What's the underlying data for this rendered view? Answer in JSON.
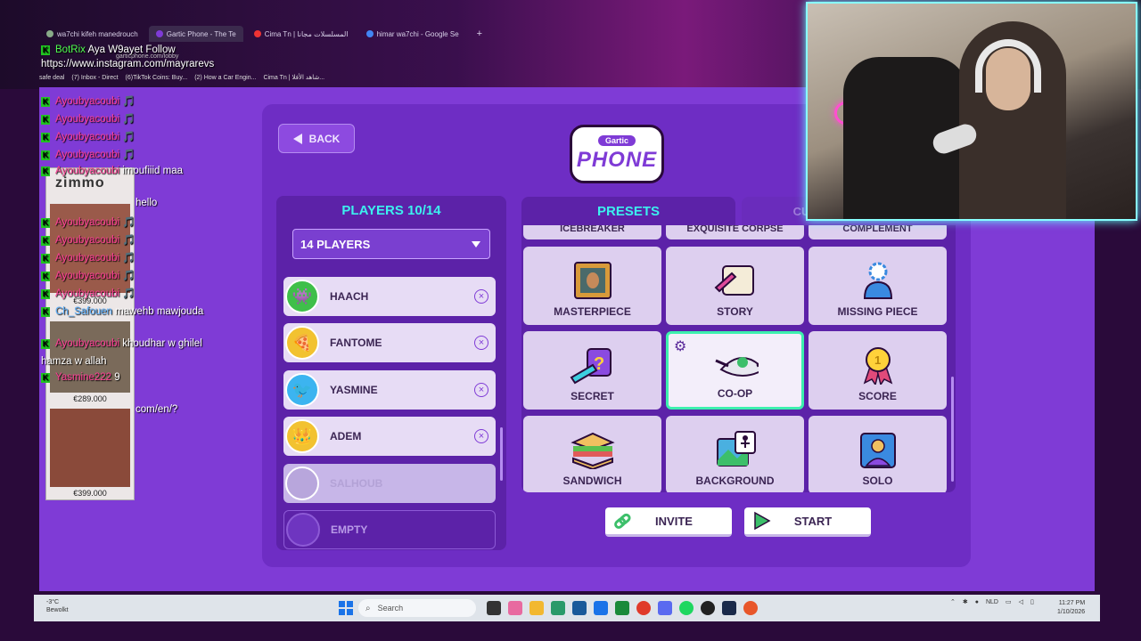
{
  "browser": {
    "tabs": [
      {
        "label": "wa7chi kifeh manedrouch",
        "active": false
      },
      {
        "label": "Gartic Phone - The Te",
        "active": true
      },
      {
        "label": "Cima Tn | المسلسلات مجانا",
        "active": false
      },
      {
        "label": "himar wa7chi - Google Se",
        "active": false
      }
    ],
    "new_tab": "+",
    "url": "garticphone.com/lobby",
    "bookmarks": [
      "safe deal",
      "(7) Inbox - Direct",
      "(6)TikTok Coins: Buy...",
      "(2) How a Car Engin...",
      "Cima Tn | شاهد الأفلا..."
    ]
  },
  "game": {
    "back_label": "BACK",
    "logo_top": "Gartic",
    "logo_main": "PHONE",
    "players_title": "PLAYERS 10/14",
    "players_select": "14 PLAYERS",
    "players": [
      {
        "name": "HAACH",
        "icon": "green-monster-avatar",
        "color": "#3fbf4a"
      },
      {
        "name": "FANTOME",
        "icon": "pizza-avatar",
        "color": "#f2c230"
      },
      {
        "name": "YASMINE",
        "icon": "blue-bird-avatar",
        "color": "#3cb4f0"
      },
      {
        "name": "ADEM",
        "icon": "crowned-king-avatar",
        "color": "#f2c230"
      },
      {
        "name": "SALHOUB",
        "icon": "faded-avatar",
        "color": "#b8a6dc"
      },
      {
        "name": "EMPTY",
        "icon": "empty-slot-avatar",
        "color": "#6e35c0"
      }
    ],
    "remove_symbol": "×",
    "presets_tab": "PRESETS",
    "custom_tab": "CUSTOM SETTINGS",
    "preset_top_row": [
      "ICEBREAKER",
      "EXQUISITE CORPSE",
      "COMPLEMENT"
    ],
    "presets": [
      {
        "label": "MASTERPIECE",
        "icon": "painting-icon"
      },
      {
        "label": "STORY",
        "icon": "scroll-quill-icon"
      },
      {
        "label": "MISSING PIECE",
        "icon": "puzzle-person-icon"
      },
      {
        "label": "SECRET",
        "icon": "question-pencil-icon"
      },
      {
        "label": "CO-OP",
        "icon": "cooperative-drawing-icon",
        "selected": true
      },
      {
        "label": "SCORE",
        "icon": "medal-icon"
      },
      {
        "label": "SANDWICH",
        "icon": "sandwich-icon"
      },
      {
        "label": "BACKGROUND",
        "icon": "picture-figure-icon"
      },
      {
        "label": "SOLO",
        "icon": "solo-frame-icon"
      }
    ],
    "invite_label": "INVITE",
    "start_label": "START"
  },
  "chat": {
    "lines": [
      {
        "user": "BotRix",
        "text": "Aya W9ayet Follow",
        "color": "#50ff50"
      },
      {
        "user": "",
        "text": "https://www.instagram.com/mayrarevs",
        "color": "#ffffff"
      },
      {
        "user": "Ayoubyacoubi",
        "text": "🎵",
        "color": "#ff3e96"
      },
      {
        "user": "Ayoubyacoubi",
        "text": "🎵",
        "color": "#ff3e96"
      },
      {
        "user": "Ayoubyacoubi",
        "text": "🎵",
        "color": "#ff3e96"
      },
      {
        "user": "Ayoubyacoubi",
        "text": "🎵",
        "color": "#ff3e96"
      },
      {
        "user": "Ayoubyacoubi",
        "text": "imoufiiid maa",
        "color": "#ff3e96"
      },
      {
        "user": "",
        "text": "hello",
        "color": "#50ff50"
      },
      {
        "user": "Ayoubyacoubi",
        "text": "🎵",
        "color": "#ff3e96"
      },
      {
        "user": "Ayoubyacoubi",
        "text": "🎵",
        "color": "#ff3e96"
      },
      {
        "user": "Ayoubyacoubi",
        "text": "🎵",
        "color": "#ff3e96"
      },
      {
        "user": "Ayoubyacoubi",
        "text": "🎵",
        "color": "#ff3e96"
      },
      {
        "user": "Ayoubyacoubi",
        "text": "🎵",
        "color": "#ff3e96"
      },
      {
        "user": "Ch_Safouen",
        "text": "mawehb mawjouda",
        "color": "#5ab0ff"
      },
      {
        "user": "Ayoubyacoubi",
        "text": "khoudhar w ghilel",
        "color": "#ff3e96"
      },
      {
        "user": "",
        "text": "hamza w allah",
        "color": "#ffffff"
      },
      {
        "user": "Yasmine222",
        "text": "9",
        "color": "#ff3e96"
      },
      {
        "user": "",
        "text": "com/en/?",
        "color": "#ffffff"
      }
    ],
    "ad": {
      "brand": "zimmo",
      "prices": [
        "€399.000",
        "€289.000",
        "€399.000"
      ]
    }
  },
  "taskbar": {
    "weather_temp": "-3°C",
    "weather_desc": "Bewolkt",
    "search_placeholder": "Search",
    "lang": "NLD",
    "time": "11:27 PM",
    "date": "1/10/2026"
  }
}
